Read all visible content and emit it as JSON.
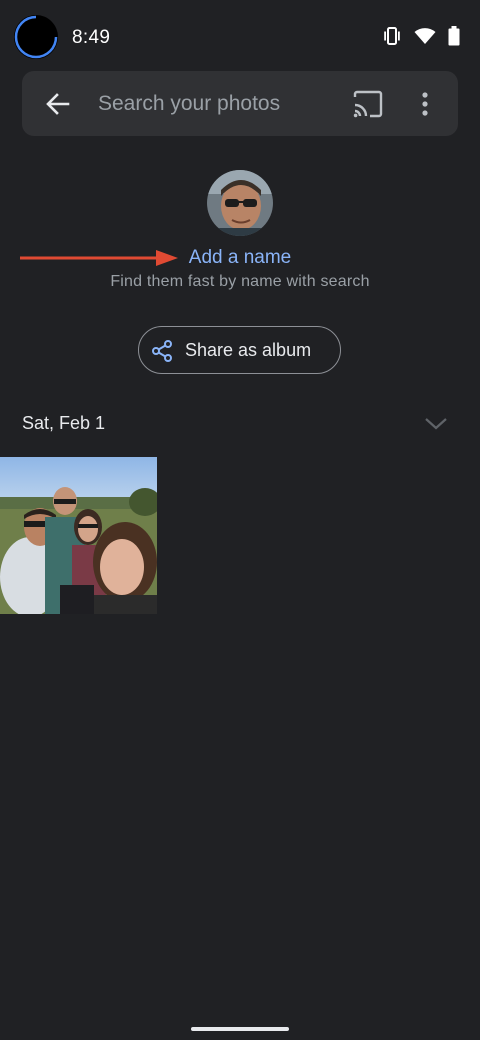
{
  "status_bar": {
    "time": "8:49",
    "icons": [
      "vibrate-icon",
      "wifi-icon",
      "battery-icon"
    ]
  },
  "search_bar": {
    "placeholder": "Search your photos",
    "icons": [
      "back-arrow-icon",
      "cast-icon",
      "more-vert-icon"
    ]
  },
  "face": {
    "add_name_label": "Add a name",
    "hint": "Find them fast by name with search"
  },
  "share_button": {
    "label": "Share as album"
  },
  "section": {
    "date": "Sat, Feb 1"
  },
  "colors": {
    "background": "#202124",
    "search_bar": "#303134",
    "link": "#8ab4f8",
    "annotation_arrow": "#e04a33"
  }
}
